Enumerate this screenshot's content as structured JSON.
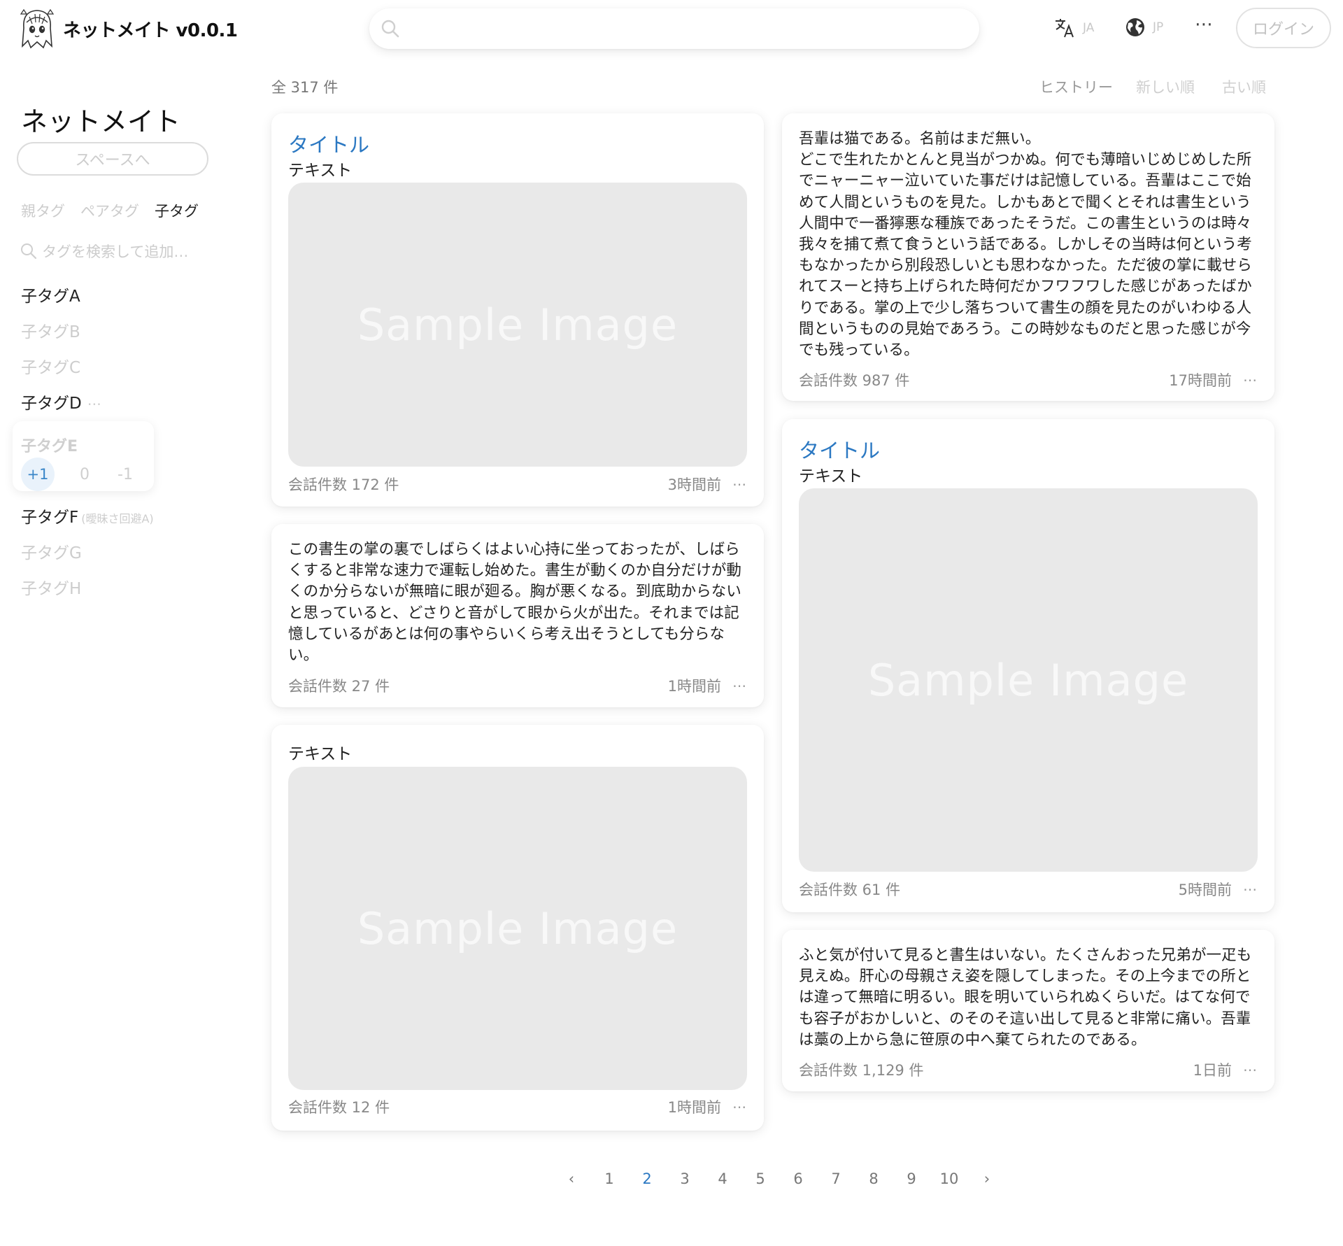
{
  "header": {
    "app_name": "ネットメイト v0.0.1",
    "search_placeholder": "",
    "language_code": "JA",
    "region_code": "JP",
    "more": "⋯",
    "login_label": "ログイン"
  },
  "sidebar": {
    "title": "ネットメイト",
    "space_button": "スペースへ",
    "tabs": [
      "親タグ",
      "ペアタグ",
      "子タグ"
    ],
    "active_tab": "子タグ",
    "tag_search_placeholder": "タグを検索して追加…",
    "tags": [
      {
        "label": "子タグA",
        "active": true
      },
      {
        "label": "子タグB",
        "active": false
      },
      {
        "label": "子タグC",
        "active": false
      },
      {
        "label": "子タグD",
        "active": true,
        "dots": "⋯"
      },
      {
        "label": "子タグE",
        "active": false
      },
      {
        "label": "子タグF",
        "active": true,
        "note": "(曖昧さ回避A)"
      },
      {
        "label": "子タグG",
        "active": false
      },
      {
        "label": "子タグH",
        "active": false
      }
    ],
    "vote": {
      "plus": "+1",
      "zero": "0",
      "minus": "-1",
      "selected": "+1"
    }
  },
  "main": {
    "total": "全 317 件",
    "sort": [
      "ヒストリー",
      "新しい順",
      "古い順"
    ],
    "active_sort": "ヒストリー",
    "image_placeholder": "Sample Image",
    "cards": [
      {
        "title": "タイトル",
        "text": "テキスト",
        "count": "会話件数 172 件",
        "time": "3時間前",
        "more": "⋯"
      },
      {
        "body": "この書生の掌の裏でしばらくはよい心持に坐っておったが、しばらくすると非常な速力で運転し始めた。書生が動くのか自分だけが動くのか分らないが無暗に眼が廻る。胸が悪くなる。到底助からないと思っていると、どさりと音がして眼から火が出た。それまでは記憶しているがあとは何の事やらいくら考え出そうとしても分らない。",
        "count": "会話件数 27 件",
        "time": "1時間前",
        "more": "⋯"
      },
      {
        "text": "テキスト",
        "count": "会話件数 12 件",
        "time": "1時間前",
        "more": "⋯"
      },
      {
        "body": "吾輩は猫である。名前はまだ無い。\nどこで生れたかとんと見当がつかぬ。何でも薄暗いじめじめした所でニャーニャー泣いていた事だけは記憶している。吾輩はここで始めて人間というものを見た。しかもあとで聞くとそれは書生という人間中で一番獰悪な種族であったそうだ。この書生というのは時々我々を捕て煮て食うという話である。しかしその当時は何という考もなかったから別段恐しいとも思わなかった。ただ彼の掌に載せられてスーと持ち上げられた時何だかフワフワした感じがあったばかりである。掌の上で少し落ちついて書生の顔を見たのがいわゆる人間というものの見始であろう。この時妙なものだと思った感じが今でも残っている。",
        "count": "会話件数 987 件",
        "time": "17時間前",
        "more": "⋯"
      },
      {
        "title": "タイトル",
        "text": "テキスト",
        "count": "会話件数 61 件",
        "time": "5時間前",
        "more": "⋯"
      },
      {
        "body": "ふと気が付いて見ると書生はいない。たくさんおった兄弟が一疋も見えぬ。肝心の母親さえ姿を隠してしまった。その上今までの所とは違って無暗に明るい。眼を明いていられぬくらいだ。はてな何でも容子がおかしいと、のそのそ這い出して見ると非常に痛い。吾輩は藁の上から急に笹原の中へ棄てられたのである。",
        "count": "会話件数 1,129 件",
        "time": "1日前",
        "more": "⋯"
      }
    ]
  },
  "pagination": {
    "prev": "‹",
    "next": "›",
    "pages": [
      "1",
      "2",
      "3",
      "4",
      "5",
      "6",
      "7",
      "8",
      "9",
      "10"
    ],
    "current": "2"
  },
  "colors": {
    "accent": "#2b78c2",
    "muted": "#cccccc",
    "image_bg": "#e9e9e9",
    "vote_bg": "#e9f2fb"
  }
}
